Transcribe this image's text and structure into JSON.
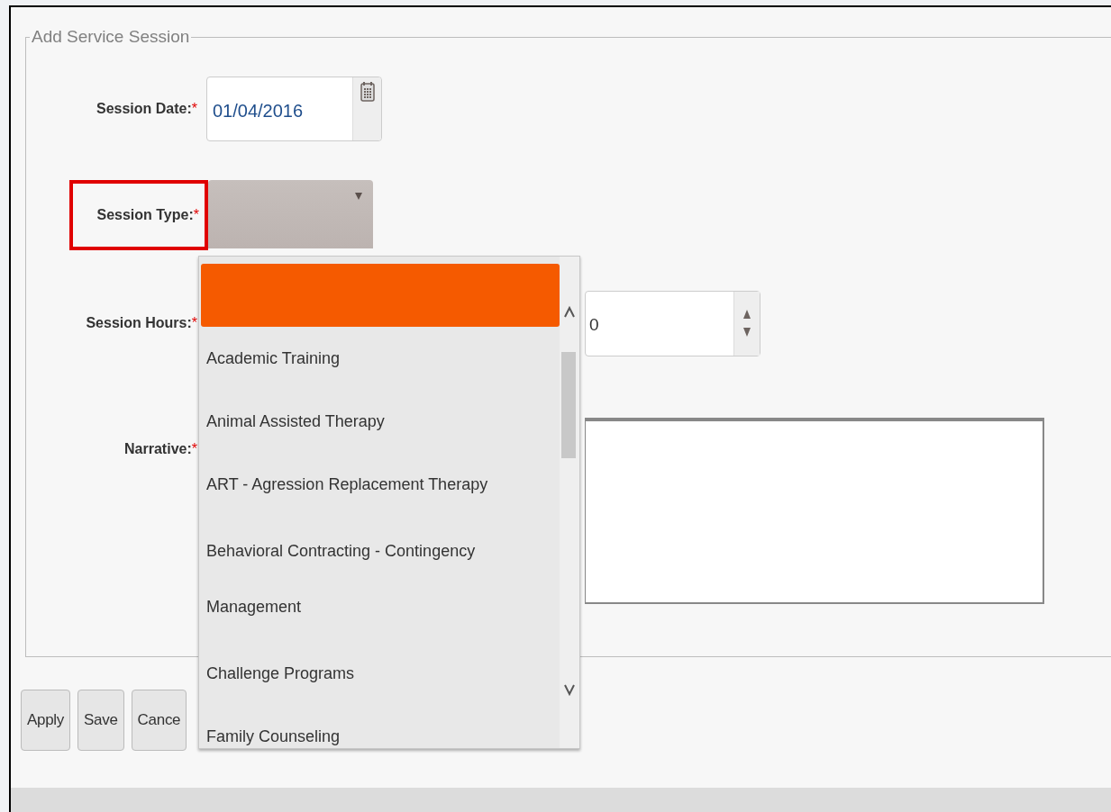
{
  "fieldset": {
    "legend": "Add Service Session"
  },
  "fields": [
    {
      "kind": "date",
      "label": "Session Date:",
      "required_mark": "*",
      "value": "01/04/2016",
      "highlighted": false
    },
    {
      "kind": "select",
      "label": "Session Type:",
      "required_mark": "*",
      "highlighted": true
    },
    {
      "kind": "number",
      "label": "Session Hours:",
      "required_mark": "*",
      "value": "0",
      "highlighted": false
    },
    {
      "kind": "textarea",
      "label": "Narrative:",
      "required_mark": "*",
      "highlighted": false
    }
  ],
  "buttons": [
    "Apply",
    "Save",
    "Cance"
  ],
  "dropdown": {
    "options": [
      {
        "selected": true
      },
      {
        "label": "Academic Training",
        "selected": false
      },
      {
        "label": "Animal Assisted Therapy",
        "selected": false
      },
      {
        "label": "ART - Agression Replacement Therapy",
        "selected": false
      },
      {
        "label": "Behavioral Contracting - Contingency Management",
        "selected": false
      },
      {
        "label": "Challenge Programs",
        "selected": false
      },
      {
        "label": "Family Counseling",
        "selected": false
      }
    ]
  }
}
